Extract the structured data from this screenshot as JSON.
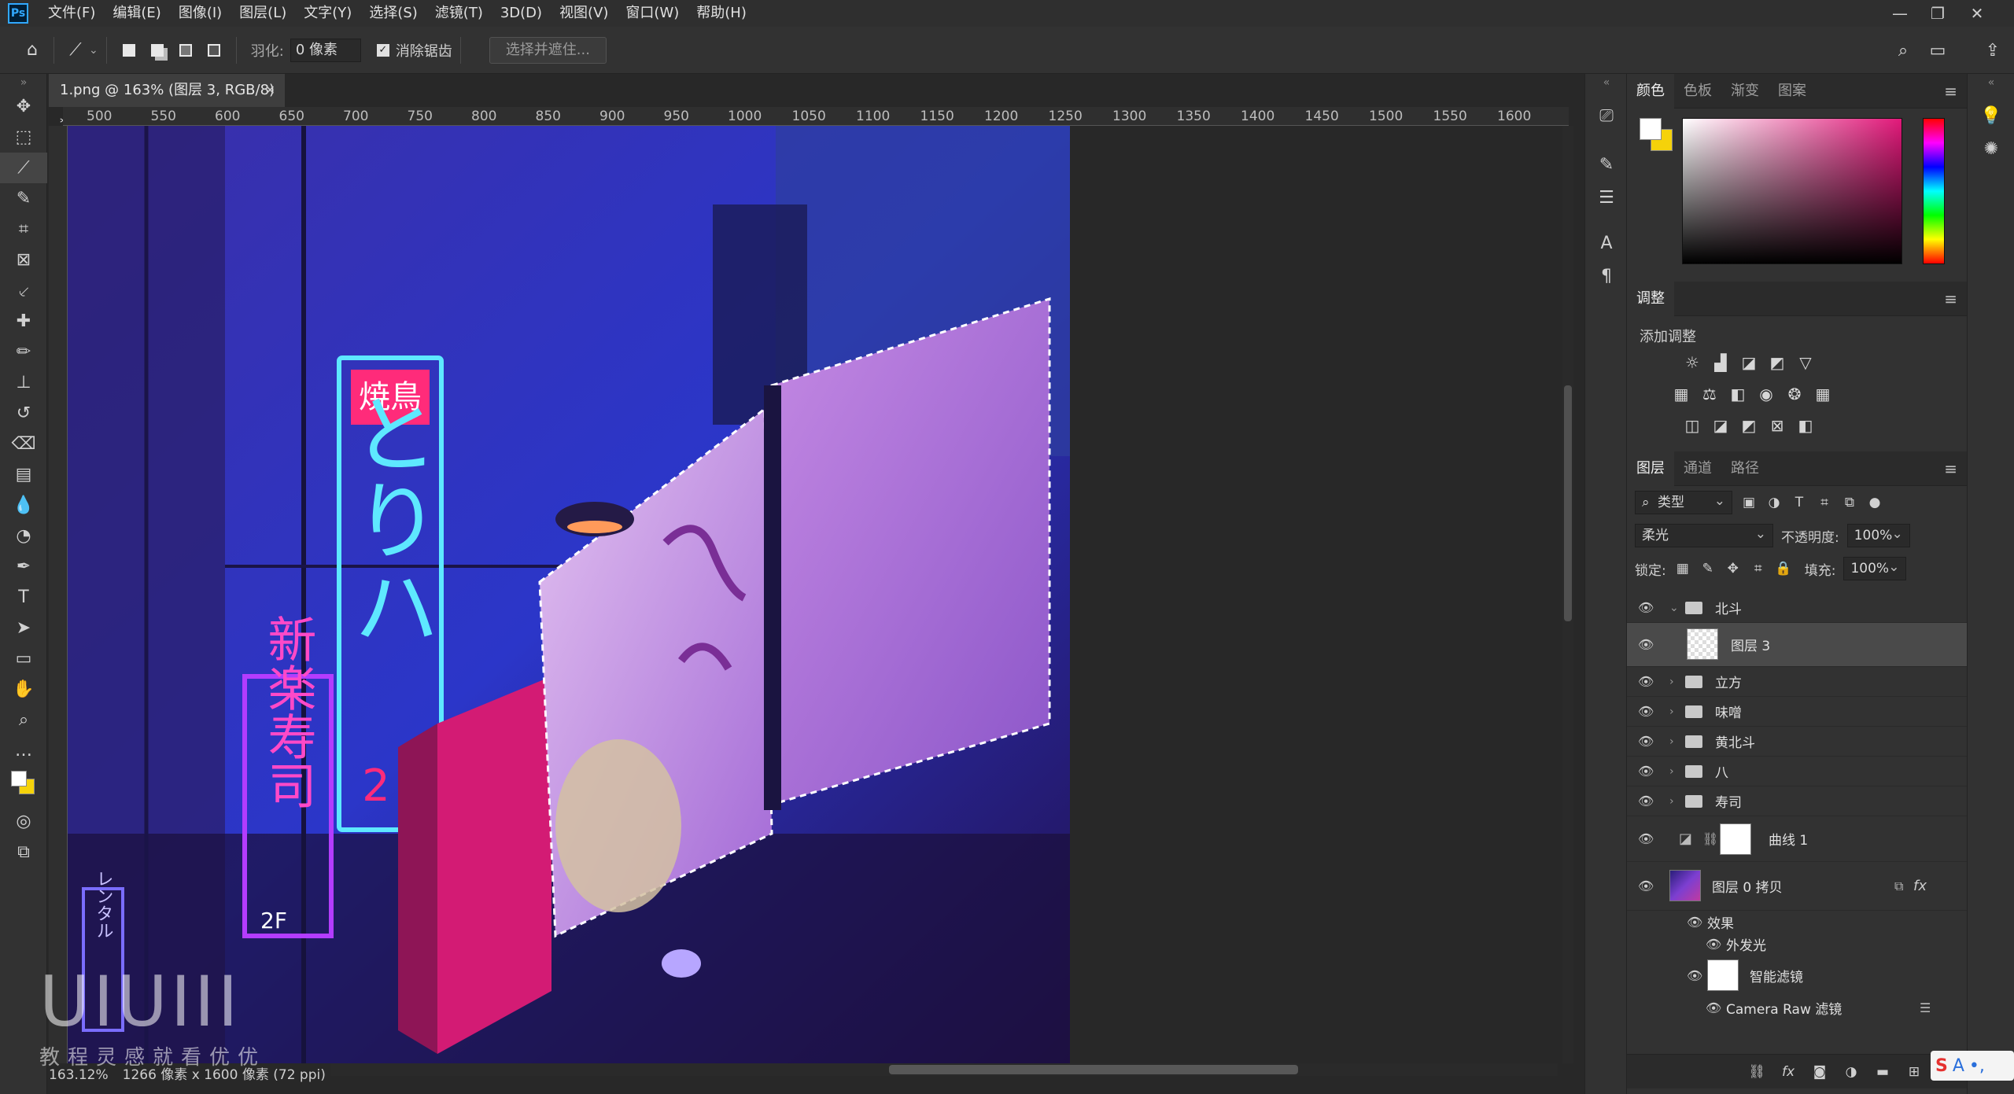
{
  "app": {
    "logo": "Ps",
    "menus": [
      "文件(F)",
      "编辑(E)",
      "图像(I)",
      "图层(L)",
      "文字(Y)",
      "选择(S)",
      "滤镜(T)",
      "3D(D)",
      "视图(V)",
      "窗口(W)",
      "帮助(H)"
    ]
  },
  "options": {
    "feather_label": "羽化:",
    "feather_value": "0 像素",
    "antialias_label": "消除锯齿",
    "select_mask_label": "选择并遮住..."
  },
  "document": {
    "tab_title": "1.png @ 163% (图层 3, RGB/8) *",
    "ruler_ticks": [
      "500",
      "550",
      "600",
      "650",
      "700",
      "750",
      "800",
      "850",
      "900",
      "950",
      "1000",
      "1050",
      "1100",
      "1150",
      "1200",
      "1250",
      "1300",
      "1350",
      "1400",
      "1450",
      "1500",
      "1550",
      "1600"
    ],
    "zoom": "163.12%",
    "doc_info": "1266 像素 x 1600 像素 (72 ppi)"
  },
  "panels": {
    "color_tabs": [
      "颜色",
      "色板",
      "渐变",
      "图案"
    ],
    "fg_color": "#ffffff",
    "bg_color": "#f5d20a",
    "adjust_tab": "调整",
    "adjust_title": "添加调整",
    "layer_tabs": [
      "图层",
      "通道",
      "路径"
    ],
    "filter_kind": "类型",
    "blend_mode": "柔光",
    "opacity_label": "不透明度:",
    "opacity_value": "100%",
    "lock_label": "锁定:",
    "fill_label": "填充:",
    "fill_value": "100%",
    "layers": [
      {
        "name": "北斗",
        "type": "group",
        "expanded": true
      },
      {
        "name": "图层 3",
        "type": "pixel",
        "selected": true
      },
      {
        "name": "立方",
        "type": "group"
      },
      {
        "name": "味噌",
        "type": "group"
      },
      {
        "name": "黄北斗",
        "type": "group"
      },
      {
        "name": "八",
        "type": "group"
      },
      {
        "name": "寿司",
        "type": "group"
      },
      {
        "name": "曲线 1",
        "type": "adjustment"
      },
      {
        "name": "图层 0 拷贝",
        "type": "smart",
        "fx": "fx"
      }
    ],
    "effects_label": "效果",
    "outer_glow_label": "外发光",
    "smart_filter_label": "智能滤镜",
    "camera_raw_label": "Camera Raw 滤镜"
  },
  "watermark": {
    "title": "UIUIII",
    "subtitle": "教程灵感就看优优"
  },
  "ime": {
    "s": "S",
    "a": "A",
    "dot": "•,"
  },
  "sign_text": {
    "yakitori": "焼鳥",
    "torihachi": "とりハ",
    "num": "2",
    "shinraku": "新楽寿司",
    "floor": "2F",
    "rental": "レンタル"
  }
}
